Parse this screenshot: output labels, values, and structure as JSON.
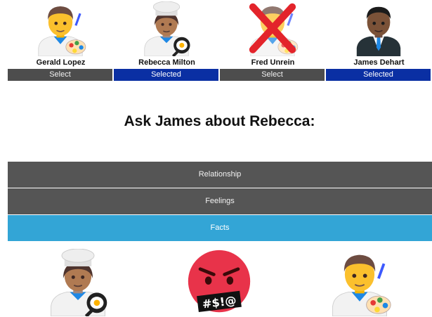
{
  "characters": [
    {
      "name": "Gerald Lopez",
      "button": "Select",
      "portrait": "man-artist-icon"
    },
    {
      "name": "Rebecca Milton",
      "button": "Selected",
      "portrait": "woman-cook-icon"
    },
    {
      "name": "Fred Unrein",
      "button": "Select",
      "portrait": "man-artist-crossed-out-icon"
    },
    {
      "name": "James Dehart",
      "button": "Selected",
      "portrait": "man-in-suit-icon"
    }
  ],
  "question": "Ask James about Rebecca:",
  "topics": [
    {
      "label": "Relationship"
    },
    {
      "label": "Feelings"
    },
    {
      "label": "Facts"
    }
  ],
  "answer_icons": [
    "woman-cook-icon",
    "angry-face-with-symbols-icon",
    "man-artist-icon"
  ],
  "symbols_text": "#$!@",
  "colors": {
    "selected_button": "#0a2fa3",
    "unselected_button": "#4d4d4d",
    "menu_button": "#555555",
    "active_menu_button": "#33a5d6",
    "strike_x": "#e3242b"
  }
}
